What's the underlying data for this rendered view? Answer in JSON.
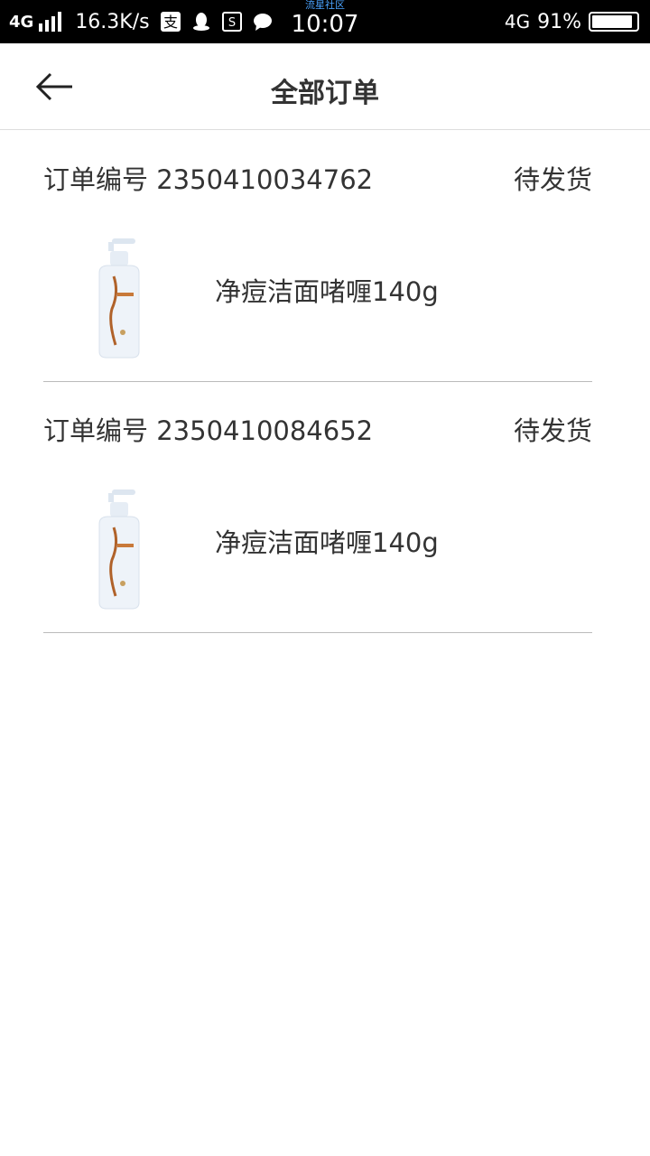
{
  "status_bar": {
    "network_left": "4G",
    "speed": "16.3K/s",
    "carrier": "流星社区",
    "time": "10:07",
    "network_right": "4G",
    "battery": "91%",
    "battery_level": 0.91,
    "icons": [
      "signal-icon",
      "alipay-icon",
      "qq-icon",
      "s-app-icon",
      "chat-icon"
    ]
  },
  "header": {
    "title": "全部订单",
    "back_icon": "back-arrow-icon"
  },
  "orders": [
    {
      "label": "订单编号",
      "number": "2350410034762",
      "status": "待发货",
      "product_name": "净痘洁面啫喱140g",
      "product_icon": "cleanser-bottle-image"
    },
    {
      "label": "订单编号",
      "number": "2350410084652",
      "status": "待发货",
      "product_name": "净痘洁面啫喱140g",
      "product_icon": "cleanser-bottle-image"
    }
  ],
  "colors": {
    "status_bar_bg": "#000000",
    "text": "#333333",
    "divider": "#bbbbbb",
    "carrier_text": "#4aa3ff"
  }
}
